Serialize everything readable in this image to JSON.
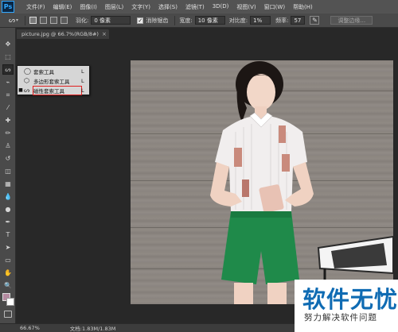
{
  "app": {
    "logo_text": "Ps"
  },
  "menubar": {
    "items": [
      "文件(F)",
      "编辑(E)",
      "图像(I)",
      "图层(L)",
      "文字(Y)",
      "选择(S)",
      "滤镜(T)",
      "3D(D)",
      "视图(V)",
      "窗口(W)",
      "帮助(H)"
    ]
  },
  "options": {
    "feather_label": "羽化:",
    "feather_value": "0 像素",
    "antialias_label": "消除锯齿",
    "antialias_checked": true,
    "width_label": "宽度:",
    "width_value": "10 像素",
    "contrast_label": "对比度:",
    "contrast_value": "1%",
    "frequency_label": "频率:",
    "frequency_value": "57",
    "refine_edge_label": "调整边缘..."
  },
  "document": {
    "tab_title": "picture.jpg @ 66.7%(RGB/8#)",
    "close_glyph": "×"
  },
  "flyout": {
    "items": [
      {
        "label": "套索工具",
        "shortcut": "L",
        "icon": "lasso-icon",
        "active": false
      },
      {
        "label": "多边形套索工具",
        "shortcut": "L",
        "icon": "polygon-lasso-icon",
        "active": false
      },
      {
        "label": "磁性套索工具",
        "shortcut": "L",
        "icon": "magnetic-lasso-icon",
        "active": true
      }
    ]
  },
  "status": {
    "zoom": "66.67%",
    "doc_info": "文档:1.83M/1.83M"
  },
  "watermark": {
    "title": "软件无忧",
    "subtitle": "努力解决软件问题"
  },
  "colors": {
    "foreground": "#b48aa0",
    "background": "#ffffff",
    "accent": "#0f6bb3",
    "highlight": "#e02020"
  }
}
